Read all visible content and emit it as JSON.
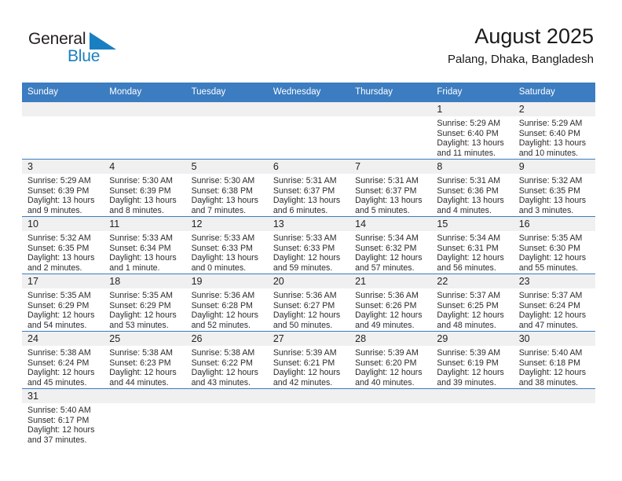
{
  "brand": {
    "name_top": "General",
    "name_bottom": "Blue",
    "flag_icon": "triangle-flag-icon",
    "color_blue": "#1a7fc1",
    "color_black": "#231f20"
  },
  "header": {
    "title": "August 2025",
    "subtitle": "Palang, Dhaka, Bangladesh"
  },
  "theme": {
    "header_bg": "#3c7cc0",
    "header_text": "#ffffff",
    "daynum_bg": "#f0f0f0",
    "row_divider": "#3c7cc0"
  },
  "weekday_headers": [
    "Sunday",
    "Monday",
    "Tuesday",
    "Wednesday",
    "Thursday",
    "Friday",
    "Saturday"
  ],
  "weeks": [
    [
      {
        "blank": true
      },
      {
        "blank": true
      },
      {
        "blank": true
      },
      {
        "blank": true
      },
      {
        "blank": true
      },
      {
        "day": "1",
        "sunrise": "Sunrise: 5:29 AM",
        "sunset": "Sunset: 6:40 PM",
        "daylight1": "Daylight: 13 hours",
        "daylight2": "and 11 minutes."
      },
      {
        "day": "2",
        "sunrise": "Sunrise: 5:29 AM",
        "sunset": "Sunset: 6:40 PM",
        "daylight1": "Daylight: 13 hours",
        "daylight2": "and 10 minutes."
      }
    ],
    [
      {
        "day": "3",
        "sunrise": "Sunrise: 5:29 AM",
        "sunset": "Sunset: 6:39 PM",
        "daylight1": "Daylight: 13 hours",
        "daylight2": "and 9 minutes."
      },
      {
        "day": "4",
        "sunrise": "Sunrise: 5:30 AM",
        "sunset": "Sunset: 6:39 PM",
        "daylight1": "Daylight: 13 hours",
        "daylight2": "and 8 minutes."
      },
      {
        "day": "5",
        "sunrise": "Sunrise: 5:30 AM",
        "sunset": "Sunset: 6:38 PM",
        "daylight1": "Daylight: 13 hours",
        "daylight2": "and 7 minutes."
      },
      {
        "day": "6",
        "sunrise": "Sunrise: 5:31 AM",
        "sunset": "Sunset: 6:37 PM",
        "daylight1": "Daylight: 13 hours",
        "daylight2": "and 6 minutes."
      },
      {
        "day": "7",
        "sunrise": "Sunrise: 5:31 AM",
        "sunset": "Sunset: 6:37 PM",
        "daylight1": "Daylight: 13 hours",
        "daylight2": "and 5 minutes."
      },
      {
        "day": "8",
        "sunrise": "Sunrise: 5:31 AM",
        "sunset": "Sunset: 6:36 PM",
        "daylight1": "Daylight: 13 hours",
        "daylight2": "and 4 minutes."
      },
      {
        "day": "9",
        "sunrise": "Sunrise: 5:32 AM",
        "sunset": "Sunset: 6:35 PM",
        "daylight1": "Daylight: 13 hours",
        "daylight2": "and 3 minutes."
      }
    ],
    [
      {
        "day": "10",
        "sunrise": "Sunrise: 5:32 AM",
        "sunset": "Sunset: 6:35 PM",
        "daylight1": "Daylight: 13 hours",
        "daylight2": "and 2 minutes."
      },
      {
        "day": "11",
        "sunrise": "Sunrise: 5:33 AM",
        "sunset": "Sunset: 6:34 PM",
        "daylight1": "Daylight: 13 hours",
        "daylight2": "and 1 minute."
      },
      {
        "day": "12",
        "sunrise": "Sunrise: 5:33 AM",
        "sunset": "Sunset: 6:33 PM",
        "daylight1": "Daylight: 13 hours",
        "daylight2": "and 0 minutes."
      },
      {
        "day": "13",
        "sunrise": "Sunrise: 5:33 AM",
        "sunset": "Sunset: 6:33 PM",
        "daylight1": "Daylight: 12 hours",
        "daylight2": "and 59 minutes."
      },
      {
        "day": "14",
        "sunrise": "Sunrise: 5:34 AM",
        "sunset": "Sunset: 6:32 PM",
        "daylight1": "Daylight: 12 hours",
        "daylight2": "and 57 minutes."
      },
      {
        "day": "15",
        "sunrise": "Sunrise: 5:34 AM",
        "sunset": "Sunset: 6:31 PM",
        "daylight1": "Daylight: 12 hours",
        "daylight2": "and 56 minutes."
      },
      {
        "day": "16",
        "sunrise": "Sunrise: 5:35 AM",
        "sunset": "Sunset: 6:30 PM",
        "daylight1": "Daylight: 12 hours",
        "daylight2": "and 55 minutes."
      }
    ],
    [
      {
        "day": "17",
        "sunrise": "Sunrise: 5:35 AM",
        "sunset": "Sunset: 6:29 PM",
        "daylight1": "Daylight: 12 hours",
        "daylight2": "and 54 minutes."
      },
      {
        "day": "18",
        "sunrise": "Sunrise: 5:35 AM",
        "sunset": "Sunset: 6:29 PM",
        "daylight1": "Daylight: 12 hours",
        "daylight2": "and 53 minutes."
      },
      {
        "day": "19",
        "sunrise": "Sunrise: 5:36 AM",
        "sunset": "Sunset: 6:28 PM",
        "daylight1": "Daylight: 12 hours",
        "daylight2": "and 52 minutes."
      },
      {
        "day": "20",
        "sunrise": "Sunrise: 5:36 AM",
        "sunset": "Sunset: 6:27 PM",
        "daylight1": "Daylight: 12 hours",
        "daylight2": "and 50 minutes."
      },
      {
        "day": "21",
        "sunrise": "Sunrise: 5:36 AM",
        "sunset": "Sunset: 6:26 PM",
        "daylight1": "Daylight: 12 hours",
        "daylight2": "and 49 minutes."
      },
      {
        "day": "22",
        "sunrise": "Sunrise: 5:37 AM",
        "sunset": "Sunset: 6:25 PM",
        "daylight1": "Daylight: 12 hours",
        "daylight2": "and 48 minutes."
      },
      {
        "day": "23",
        "sunrise": "Sunrise: 5:37 AM",
        "sunset": "Sunset: 6:24 PM",
        "daylight1": "Daylight: 12 hours",
        "daylight2": "and 47 minutes."
      }
    ],
    [
      {
        "day": "24",
        "sunrise": "Sunrise: 5:38 AM",
        "sunset": "Sunset: 6:24 PM",
        "daylight1": "Daylight: 12 hours",
        "daylight2": "and 45 minutes."
      },
      {
        "day": "25",
        "sunrise": "Sunrise: 5:38 AM",
        "sunset": "Sunset: 6:23 PM",
        "daylight1": "Daylight: 12 hours",
        "daylight2": "and 44 minutes."
      },
      {
        "day": "26",
        "sunrise": "Sunrise: 5:38 AM",
        "sunset": "Sunset: 6:22 PM",
        "daylight1": "Daylight: 12 hours",
        "daylight2": "and 43 minutes."
      },
      {
        "day": "27",
        "sunrise": "Sunrise: 5:39 AM",
        "sunset": "Sunset: 6:21 PM",
        "daylight1": "Daylight: 12 hours",
        "daylight2": "and 42 minutes."
      },
      {
        "day": "28",
        "sunrise": "Sunrise: 5:39 AM",
        "sunset": "Sunset: 6:20 PM",
        "daylight1": "Daylight: 12 hours",
        "daylight2": "and 40 minutes."
      },
      {
        "day": "29",
        "sunrise": "Sunrise: 5:39 AM",
        "sunset": "Sunset: 6:19 PM",
        "daylight1": "Daylight: 12 hours",
        "daylight2": "and 39 minutes."
      },
      {
        "day": "30",
        "sunrise": "Sunrise: 5:40 AM",
        "sunset": "Sunset: 6:18 PM",
        "daylight1": "Daylight: 12 hours",
        "daylight2": "and 38 minutes."
      }
    ],
    [
      {
        "day": "31",
        "sunrise": "Sunrise: 5:40 AM",
        "sunset": "Sunset: 6:17 PM",
        "daylight1": "Daylight: 12 hours",
        "daylight2": "and 37 minutes."
      },
      {
        "blank": true
      },
      {
        "blank": true
      },
      {
        "blank": true
      },
      {
        "blank": true
      },
      {
        "blank": true
      },
      {
        "blank": true
      }
    ]
  ]
}
